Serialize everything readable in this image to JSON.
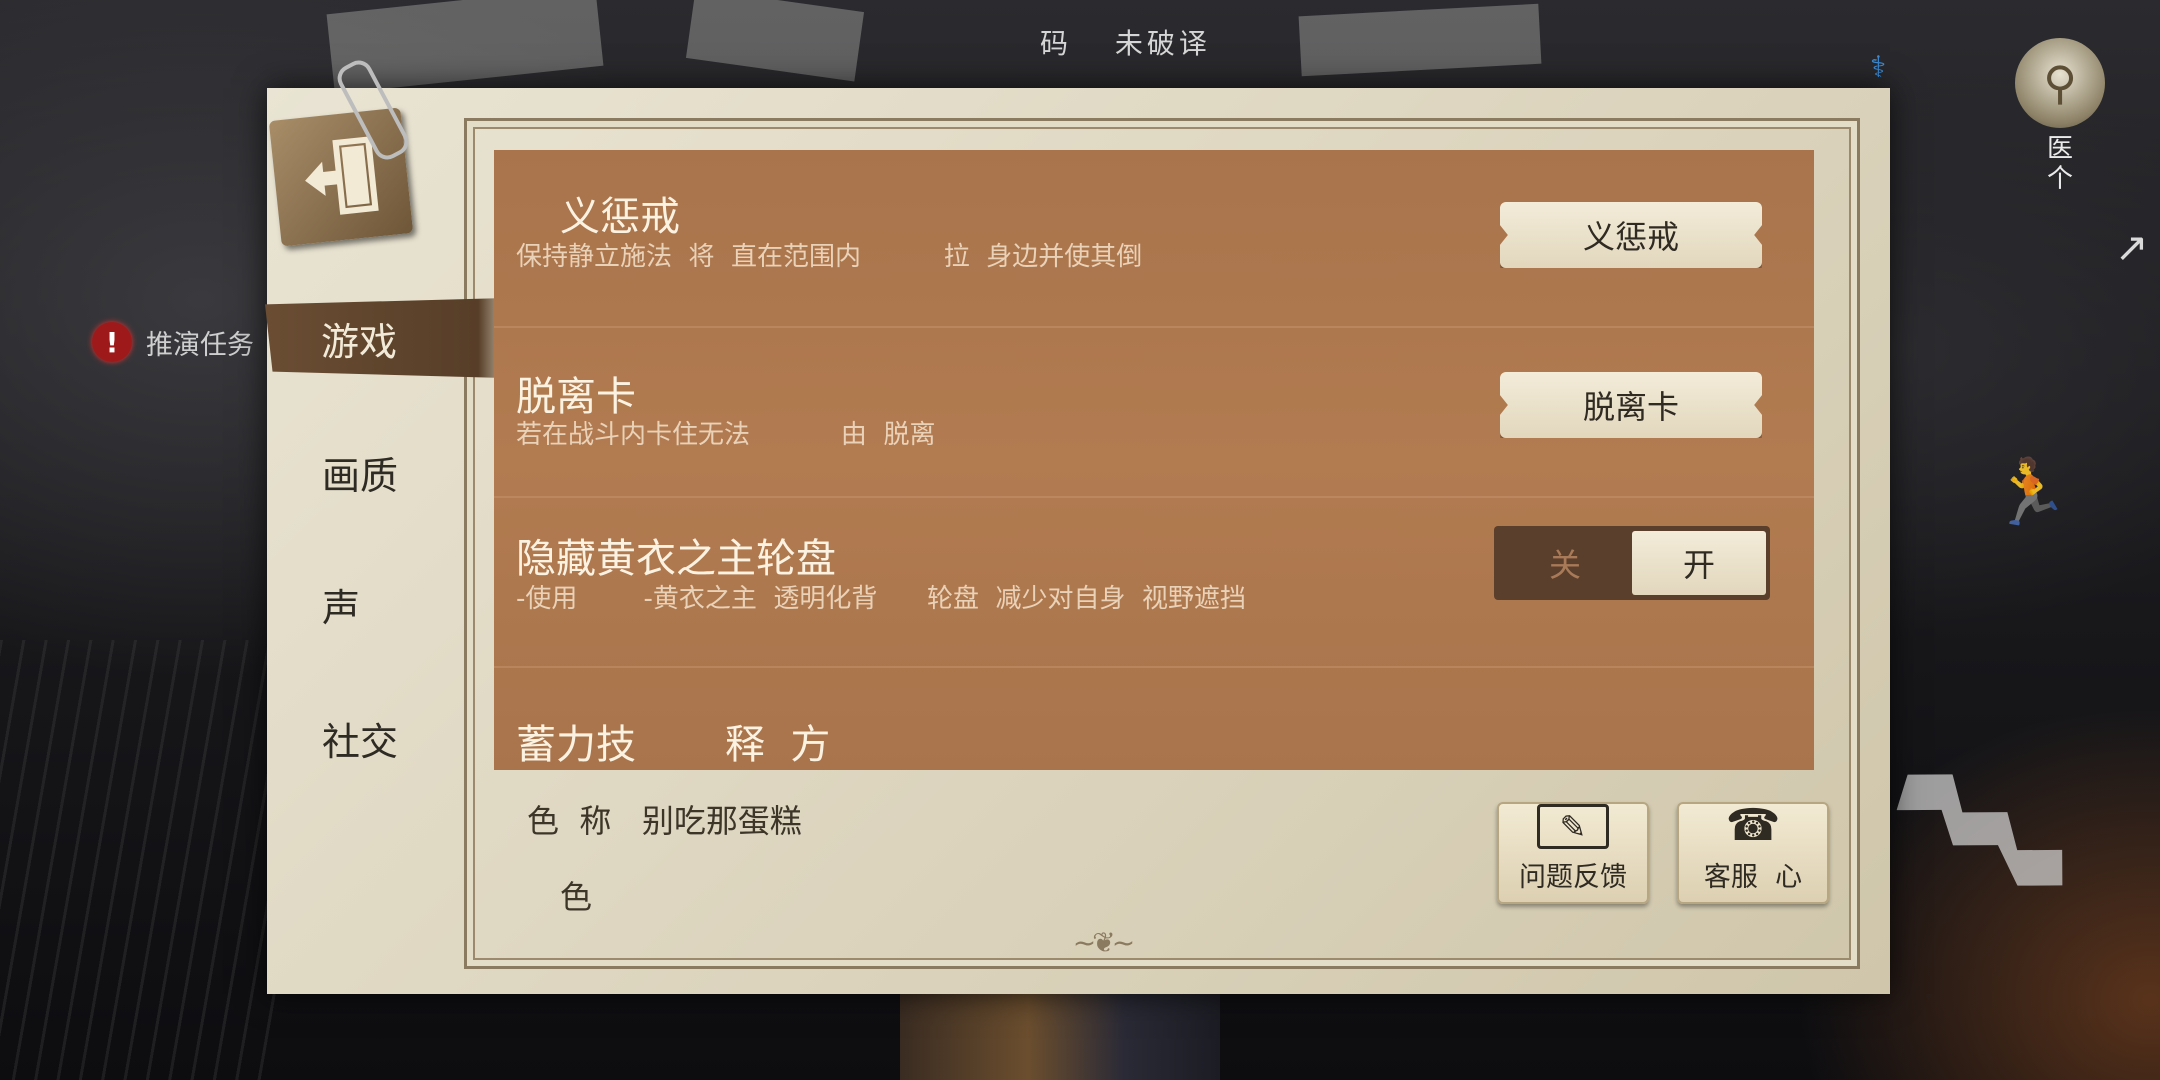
{
  "background": {
    "status_text": [
      "码",
      "未破译"
    ],
    "side_task_label": "推演任务",
    "side_task_icon": "exclamation-icon",
    "role_label_lines": [
      "医",
      "个"
    ],
    "role_icon": "doctor-avatar-icon"
  },
  "panel": {
    "exit_icon": "exit-door-icon",
    "tabs": [
      {
        "label": "游戏",
        "active": true
      },
      {
        "label": "画质",
        "active": false
      },
      {
        "label": "声",
        "active": false
      },
      {
        "label": "社交",
        "active": false
      }
    ],
    "settings": {
      "chastise": {
        "title": "义惩戒",
        "desc": "保持静立施法  将  直在范围内          拉  身边并使其倒",
        "button": "义惩戒"
      },
      "escape_card": {
        "title": "脱离卡",
        "desc": "若在战斗内卡住无法           由  脱离",
        "button": "脱离卡"
      },
      "hide_wheel": {
        "title": "隐藏黄衣之主轮盘",
        "desc": "-使用        -黄衣之主  透明化背      轮盘  减少对自身  视野遮挡",
        "toggle_off": "关",
        "toggle_on": "开",
        "state": "on"
      },
      "charge_skill": {
        "title": "蓄力技       释  方"
      }
    },
    "footer": {
      "role_line": "色  称   别吃那蛋糕",
      "color_line": "色",
      "feedback_label": "问题反馈",
      "feedback_icon": "pen-icon",
      "service_label": "客服  心",
      "service_icon": "telephone-icon"
    }
  },
  "colors": {
    "list_bg": "#b27b50",
    "panel_paper": "#dcd4bd",
    "active_tab": "#573e28",
    "title_text": "#fbf2e2"
  }
}
